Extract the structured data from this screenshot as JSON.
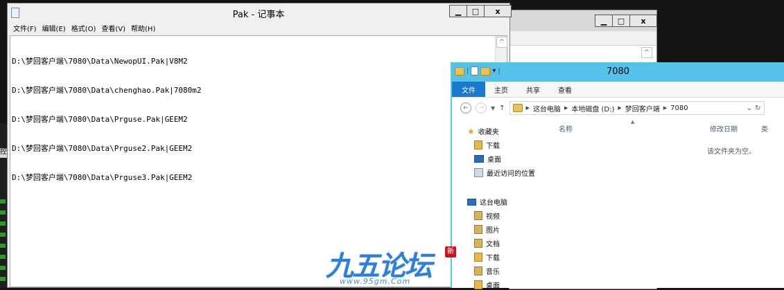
{
  "notepad": {
    "title": "Pak - 记事本",
    "menu": [
      "文件(F)",
      "编辑(E)",
      "格式(O)",
      "查看(V)",
      "帮助(H)"
    ],
    "lines": [
      "D:\\梦回客户端\\7080\\Data\\NewopUI.Pak|V8M2",
      "D:\\梦回客户端\\7080\\Data\\chenghao.Pak|7080m2",
      "D:\\梦回客户端\\7080\\Data\\Prguse.Pak|GEEM2",
      "D:\\梦回客户端\\7080\\Data\\Prguse2.Pak|GEEM2",
      "D:\\梦回客户端\\7080\\Data\\Prguse3.Pak|GEEM2"
    ]
  },
  "window_buttons": {
    "minimize": "▁",
    "maximize": "□",
    "close": "x"
  },
  "explorer": {
    "title": "7080",
    "ribbon_tabs": [
      "文件",
      "主页",
      "共享",
      "查看"
    ],
    "breadcrumb": [
      "这台电脑",
      "本地磁盘 (D:)",
      "梦回客户端",
      "7080"
    ],
    "columns": {
      "name": "名称",
      "modified": "修改日期",
      "type": "类"
    },
    "empty_message": "该文件夹为空。",
    "favorites": {
      "header": "收藏夹",
      "items": [
        "下载",
        "桌面",
        "最近访问的位置"
      ]
    },
    "this_pc": {
      "header": "这台电脑",
      "items": [
        "视频",
        "图片",
        "文档",
        "下载",
        "音乐",
        "桌面"
      ]
    }
  },
  "left_strip": {
    "label": "控"
  },
  "watermark": {
    "text": "九五论坛",
    "url": "www.95gm.Com",
    "seal": "新"
  }
}
